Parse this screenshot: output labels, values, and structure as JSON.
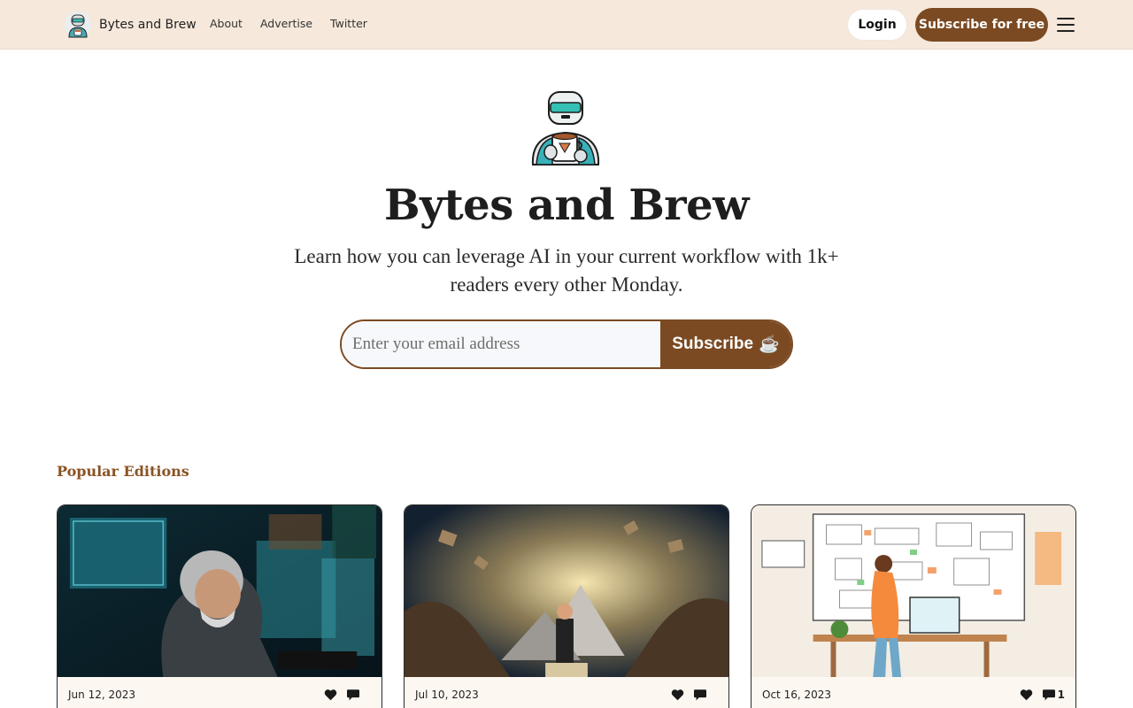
{
  "nav": {
    "brand_name": "Bytes and Brew",
    "links": [
      "About",
      "Advertise",
      "Twitter"
    ],
    "login_label": "Login",
    "subscribe_label": "Subscribe for free"
  },
  "hero": {
    "title": "Bytes and Brew",
    "tagline": "Learn how you can leverage AI in your current workflow with 1k+ readers every other Monday.",
    "email_placeholder": "Enter your email address",
    "subscribe_label": "Subscribe",
    "subscribe_emoji": "☕"
  },
  "popular": {
    "title": "Popular Editions",
    "cards": [
      {
        "date": "Jun 12, 2023",
        "comments": ""
      },
      {
        "date": "Jul 10, 2023",
        "comments": ""
      },
      {
        "date": "Oct 16, 2023",
        "comments": "1"
      }
    ]
  },
  "colors": {
    "brand_brown": "#7b4a22",
    "nav_bg": "#f6e8db",
    "section_title": "#8a5323"
  },
  "icons": [
    "robot-logo-icon",
    "menu-icon",
    "heart-icon",
    "comment-icon"
  ]
}
